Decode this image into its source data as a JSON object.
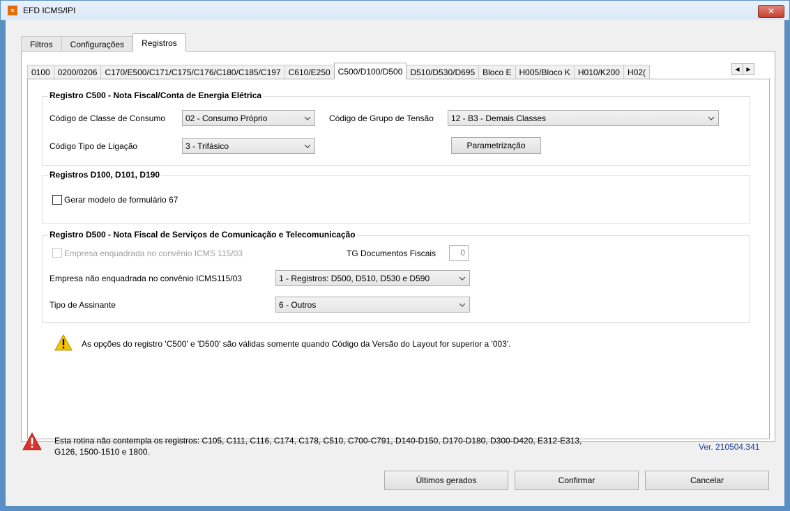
{
  "window": {
    "title": "EFD ICMS/IPI",
    "close_label": "✕"
  },
  "outer_tabs": [
    "Filtros",
    "Configurações",
    "Registros"
  ],
  "inner_tabs": [
    "0100",
    "0200/0206",
    "C170/E500/C171/C175/C176/C180/C185/C197",
    "C610/E250",
    "C500/D100/D500",
    "D510/D530/D695",
    "Bloco E",
    "H005/Bloco K",
    "H010/K200",
    "H02("
  ],
  "c500": {
    "legend": "Registro C500 - Nota Fiscal/Conta de Energia Elétrica",
    "classe_label": "Código de Classe de Consumo",
    "classe_value": "02 - Consumo Próprio",
    "grupo_label": "Código de Grupo de Tensão",
    "grupo_value": "12 - B3 - Demais Classes",
    "ligacao_label": "Código Tipo de Ligação",
    "ligacao_value": "3 - Trifásico",
    "param_button": "Parametrização"
  },
  "d100": {
    "legend": "Registros D100, D101, D190",
    "checkbox_label": "Gerar modelo de formulário 67"
  },
  "d500": {
    "legend": "Registro D500 - Nota Fiscal de Serviços de Comunicação e Telecomunicação",
    "enquadrada_label": "Empresa enquadrada no convênio ICMS 115/03",
    "tg_label": "TG Documentos Fiscais",
    "tg_value": "0",
    "nao_enq_label": "Empresa não enquadrada no convênio ICMS115/03",
    "nao_enq_value": "1 - Registros: D500, D510, D530 e D590",
    "assinante_label": "Tipo de Assinante",
    "assinante_value": "6 - Outros"
  },
  "info_msg": "As opções do registro 'C500' e 'D500' são válidas somente quando Código da Versão do Layout for superior a '003'.",
  "footer": {
    "warning_line1": "Esta rotina não contempla os registros: C105, C111, C116, C174, C178, C510, C700-C791, D140-D150, D170-D180, D300-D420, E312-E313,",
    "warning_line2": "G126, 1500-1510 e 1800.",
    "version": "Ver. 210504.341",
    "btn_ultimos": "Últimos gerados",
    "btn_confirmar": "Confirmar",
    "btn_cancelar": "Cancelar"
  },
  "colors": {
    "accent": "#5a8fc6",
    "warning_yellow": "#f5c400",
    "error_red": "#d9342b"
  }
}
